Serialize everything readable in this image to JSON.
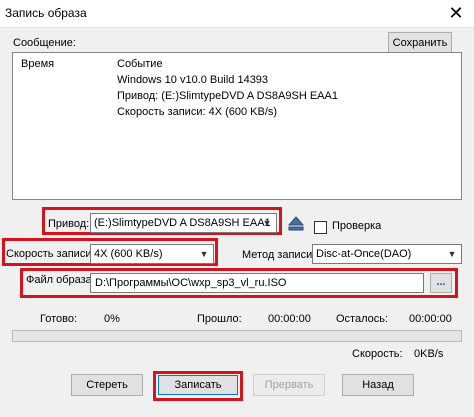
{
  "window": {
    "title": "Запись образа",
    "close_glyph": "✕"
  },
  "messages": {
    "group_label": "Сообщение:",
    "save_button": "Сохранить",
    "col_time": "Время",
    "col_event": "Событие",
    "lines": [
      "Windows 10 v10.0 Build 14393",
      "Привод: (E:)SlimtypeDVD A  DS8A9SH  EAA1",
      "Скорость записи: 4X (600 KB/s)"
    ]
  },
  "drive": {
    "label": "Привод:",
    "value": "(E:)SlimtypeDVD A  DS8A9SH  EAA1"
  },
  "verify": {
    "label": "Проверка",
    "checked": false
  },
  "speed": {
    "label": "Скорость записи:",
    "value": "4X (600 KB/s)"
  },
  "method": {
    "label": "Метод записи:",
    "value": "Disc-at-Once(DAO)"
  },
  "image_file": {
    "label": "Файл образа:",
    "value": "D:\\Программы\\ОС\\wxp_sp3_vl_ru.ISO",
    "browse": "..."
  },
  "progress": {
    "done_label": "Готово:",
    "done_value": "0%",
    "elapsed_label": "Прошло:",
    "elapsed_value": "00:00:00",
    "remaining_label": "Осталось:",
    "remaining_value": "00:00:00",
    "speed_label": "Скорость:",
    "speed_value": "0KB/s",
    "fraction": 0
  },
  "buttons": {
    "erase": "Стереть",
    "burn": "Записать",
    "abort": "Прервать",
    "back": "Назад"
  },
  "colors": {
    "highlight": "#d4141c",
    "window_bg": "#f0f0f0"
  }
}
